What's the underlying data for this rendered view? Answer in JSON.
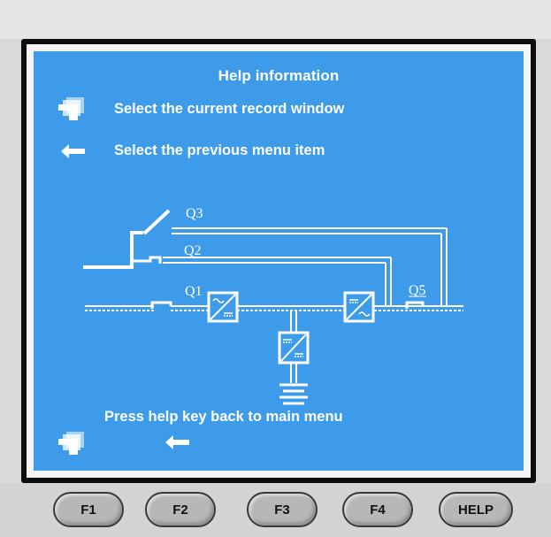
{
  "panel": {
    "title": "Help information",
    "lines": [
      {
        "icon": "record-window-icon",
        "text": "Select the current record window"
      },
      {
        "icon": "left-arrow-icon",
        "text": "Select the previous menu item"
      }
    ],
    "footer_text": "Press help key back to main menu"
  },
  "diagram": {
    "labels": {
      "q1": "Q1",
      "q2": "Q2",
      "q3": "Q3",
      "q5": "Q5"
    }
  },
  "keys": [
    {
      "label": "F1"
    },
    {
      "label": "F2"
    },
    {
      "label": "F3"
    },
    {
      "label": "F4"
    },
    {
      "label": "HELP"
    }
  ],
  "colors": {
    "screen": "#3d9be9",
    "frame": "#0d0d0d",
    "key": "#b7b7b7"
  }
}
